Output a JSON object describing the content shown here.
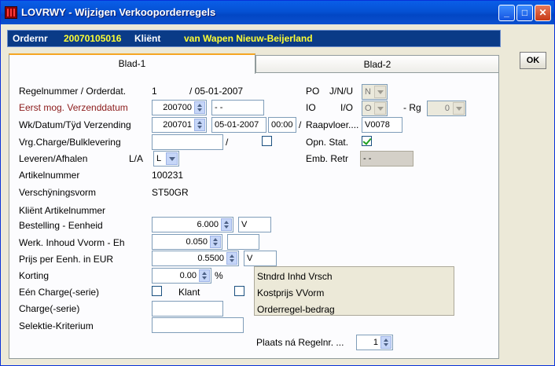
{
  "window": {
    "title": "LOVRWY - Wijzigen Verkooporderregels",
    "buttons": {
      "minimize": "_",
      "maximize": "□",
      "close": "✕"
    }
  },
  "header": {
    "order_label": "Ordernr",
    "order_value": "20070105016",
    "client_label": "Kliënt",
    "client_value": "van Wapen Nieuw-Beijerland"
  },
  "tabs": [
    {
      "label": "Blad-1"
    },
    {
      "label": "Blad-2"
    }
  ],
  "ok_label": "OK",
  "form": {
    "regelnummer": {
      "label": "Regelnummer / Orderdat.",
      "value": "1",
      "date": "/ 05-01-2007"
    },
    "eerst_mog": {
      "label": "Eerst mog. Verzenddatum",
      "week": "200700",
      "date": "- -"
    },
    "verzending": {
      "label": "Wk/Datum/Tÿd Verzending",
      "week": "200701",
      "date": "05-01-2007",
      "time": "00:00",
      "sep": "/"
    },
    "charge_bulk": {
      "label": "Vrg.Charge/Bulklevering",
      "value": "",
      "sep": "/"
    },
    "leveren": {
      "label": "Leveren/Afhalen",
      "la_label": "L/A",
      "la_value": "L"
    },
    "artikel": {
      "label": "Artikelnummer",
      "value": "100231"
    },
    "verschijning": {
      "label": "Verschÿningsvorm",
      "value": "ST50GR"
    },
    "klant_artikel": {
      "label": "Kliënt Artikelnummer"
    },
    "bestelling": {
      "label": "Bestelling - Eenheid",
      "value": "6.000",
      "unit": "V"
    },
    "werk_inhoud": {
      "label": "Werk. Inhoud Vvorm - Eh",
      "value": "0.050",
      "unit": ""
    },
    "prijs": {
      "label": "Prijs per Eenh. in EUR",
      "value": "0.5500",
      "unit": "V"
    },
    "korting": {
      "label": "Korting",
      "value": "0.00",
      "unit": "%"
    },
    "een_charge": {
      "label": "Eén Charge(-serie)",
      "klant_label": "Klant"
    },
    "charge_serie": {
      "label": "Charge(-serie)",
      "value": ""
    },
    "selektie": {
      "label": "Selektie-Kriterium",
      "value": ""
    }
  },
  "right": {
    "po": {
      "label": "PO",
      "sub_label": "J/N/U",
      "value": "N"
    },
    "io": {
      "label": "IO",
      "sub_label": "I/O",
      "value": "O",
      "rg_label": "- Rg",
      "rg_value": "0"
    },
    "raapvloer": {
      "label": "Raapvloer....",
      "value": "V0078"
    },
    "opn_stat": {
      "label": "Opn. Stat."
    },
    "emb_retr": {
      "label": "Emb. Retr",
      "value": "- -"
    }
  },
  "info": [
    "Stndrd Inhd Vrsch",
    "Kostprijs VVorm",
    "Orderregel-bedrag"
  ],
  "plaats": {
    "label": "Plaats ná Regelnr. ...",
    "value": "1"
  },
  "colors": {
    "title_bar": "#0a5ee8",
    "header_bg": "#0a3b87",
    "header_value": "#ffff33",
    "accent_red": "#8b1a1a",
    "tab_highlight": "#f5a623"
  }
}
